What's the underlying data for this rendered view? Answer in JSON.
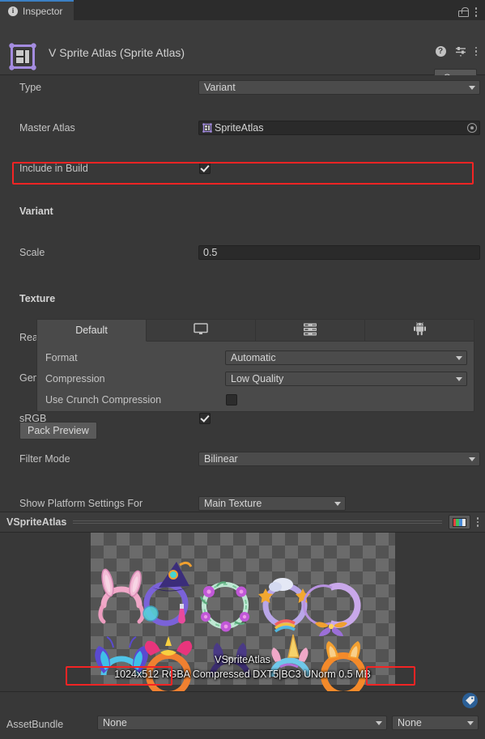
{
  "window": {
    "tab_label": "Inspector",
    "tab_icon": "info-icon",
    "lock_icon": "lock-icon",
    "menu_icon": "kebab-menu-icon"
  },
  "asset_header": {
    "icon": "sprite-atlas-icon",
    "title": "V Sprite Atlas (Sprite Atlas)",
    "help_icon": "help-icon",
    "preset_icon": "preset-icon",
    "menu_icon": "kebab-menu-icon",
    "open_button": "Open"
  },
  "properties": {
    "type_label": "Type",
    "type_value": "Variant",
    "master_atlas_label": "Master Atlas",
    "master_atlas_value": "SpriteAtlas",
    "include_in_build_label": "Include in Build",
    "include_in_build_checked": true
  },
  "variant_section": {
    "header": "Variant",
    "scale_label": "Scale",
    "scale_value": "0.5"
  },
  "texture_section": {
    "header": "Texture",
    "read_write_label": "Read/Write",
    "read_write_checked": false,
    "mipmaps_label": "Generate Mip Maps",
    "mipmaps_checked": false,
    "srgb_label": "sRGB",
    "srgb_checked": true,
    "filter_mode_label": "Filter Mode",
    "filter_mode_value": "Bilinear",
    "platform_settings_label": "Show Platform Settings For",
    "platform_settings_value": "Main Texture"
  },
  "platform_tabs": [
    {
      "label": "Default",
      "icon": "default-tab",
      "active": true
    },
    {
      "label": "",
      "icon": "standalone-monitor-icon",
      "active": false
    },
    {
      "label": "",
      "icon": "dedicated-server-icon",
      "active": false
    },
    {
      "label": "",
      "icon": "android-icon",
      "active": false
    }
  ],
  "platform_settings": {
    "format_label": "Format",
    "format_value": "Automatic",
    "compression_label": "Compression",
    "compression_value": "Low Quality",
    "crunch_label": "Use Crunch Compression",
    "crunch_checked": false
  },
  "pack_preview_button": "Pack Preview",
  "preview": {
    "title": "VSpriteAtlas",
    "rgb_icon": "rgb-channels-icon",
    "menu_icon": "kebab-menu-icon",
    "overlay_name": "VSpriteAtlas",
    "overlay_resolution": "1024x512 RGBA",
    "overlay_format": "Compressed DXT5|BC3 UNorm",
    "overlay_size": "0.5 MB"
  },
  "footer": {
    "tag_icon": "tag-icon",
    "assetbundle_label": "AssetBundle",
    "assetbundle_name": "None",
    "assetbundle_variant": "None"
  },
  "colors": {
    "accent_tab": "#3b7fc4",
    "highlight": "#f42424",
    "panel_bg": "#383838",
    "header_bg": "#3c3c3c",
    "atlas_icon": "#a48ce0",
    "tag_badge": "#2b5f96"
  }
}
